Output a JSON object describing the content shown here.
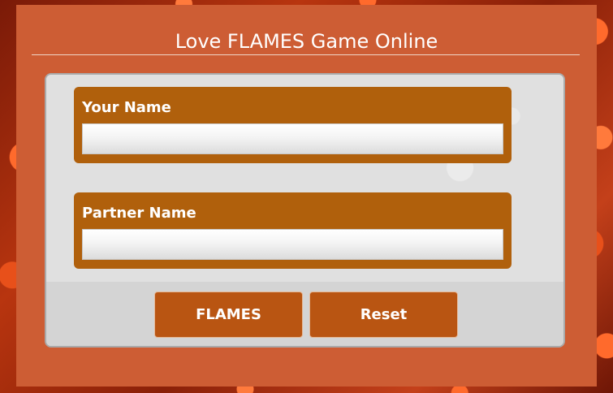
{
  "page": {
    "title": "Love FLAMES Game Online"
  },
  "form": {
    "your_name_label": "Your Name",
    "your_name_value": "",
    "partner_name_label": "Partner Name",
    "partner_name_value": ""
  },
  "buttons": {
    "flames_label": "FLAMES",
    "reset_label": "Reset"
  },
  "colors": {
    "card_background": "#cd5d34",
    "field_box": "#b0600c",
    "button": "#b95512",
    "panel": "#e2e2e2"
  }
}
